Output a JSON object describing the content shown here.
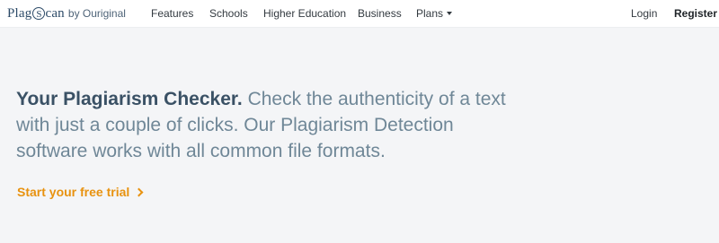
{
  "brand": {
    "logo_prefix": "Plag",
    "logo_circled_letter": "S",
    "logo_suffix": "can",
    "logo_sub": "by Ouriginal"
  },
  "nav": {
    "items": [
      {
        "label": "Features"
      },
      {
        "label": "Schools"
      },
      {
        "label": "Higher Education"
      },
      {
        "label": "Business"
      },
      {
        "label": "Plans"
      }
    ],
    "login": "Login",
    "register": "Register"
  },
  "hero": {
    "headline_strong": "Your Plagiarism Checker.",
    "headline_rest": " Check the authenticity of a text with just a couple of clicks. Our Plagiarism Detection software works with all common file formats."
  },
  "cta": {
    "label": "Start your free trial"
  },
  "colors": {
    "background": "#f4f5f7",
    "brand": "#2d4b68",
    "accent": "#e8920f",
    "hero_text": "#6f8797"
  },
  "icons": {
    "plans_caret": "caret-down-icon",
    "cta_chevron": "chevron-right-icon"
  }
}
